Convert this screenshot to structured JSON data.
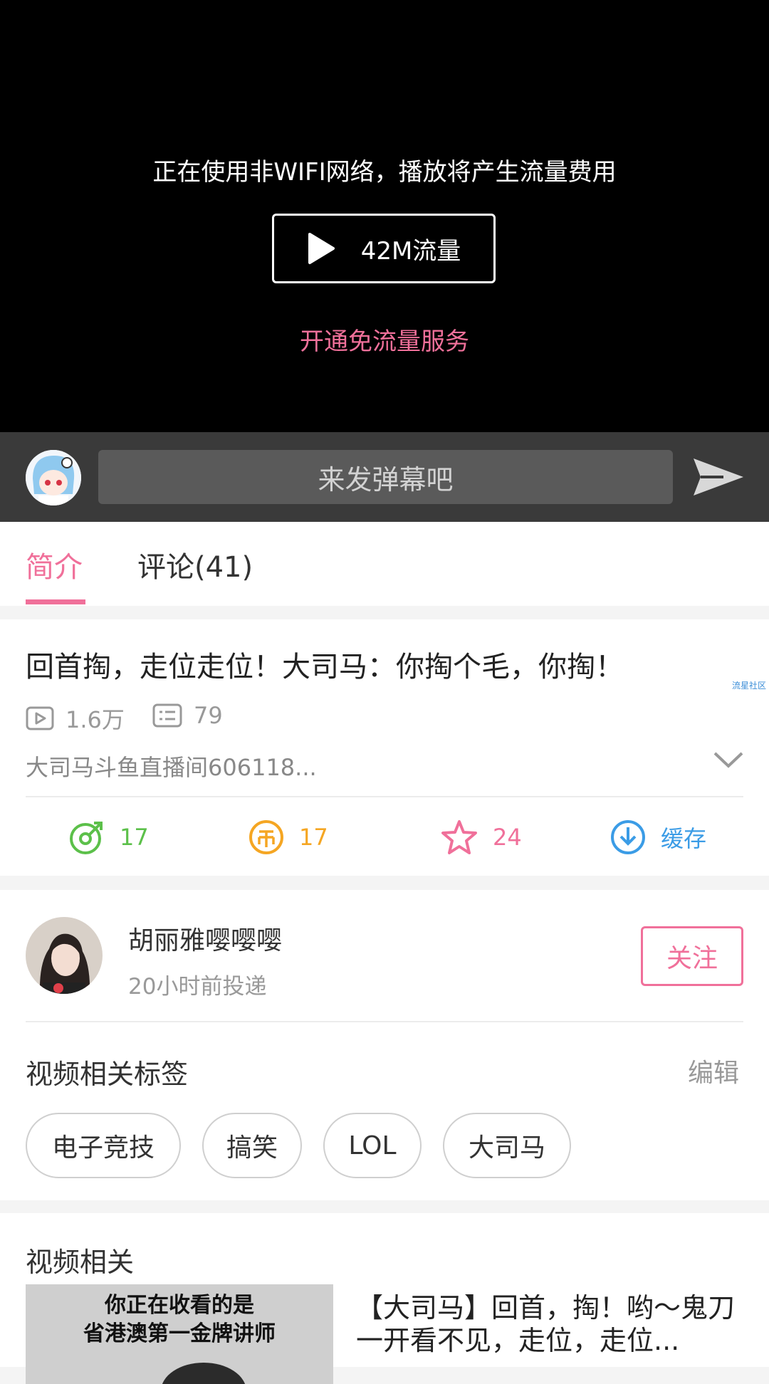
{
  "player": {
    "notice": "正在使用非WIFI网络，播放将产生流量费用",
    "play_label": "42M流量",
    "free_link": "开通免流量服务"
  },
  "danmaku": {
    "placeholder": "来发弹幕吧"
  },
  "tabs": [
    {
      "label": "简介",
      "active": true
    },
    {
      "label": "评论(41)",
      "active": false
    }
  ],
  "video": {
    "title": "回首掏，走位走位！大司马：你掏个毛，你掏！",
    "watermark": "流星社区",
    "views": "1.6万",
    "danmaku_count": "79",
    "description": "大司马斗鱼直播间606118..."
  },
  "actions": {
    "like": "17",
    "coin": "17",
    "favorite": "24",
    "cache": "缓存"
  },
  "uploader": {
    "name": "胡丽雅嘤嘤嘤",
    "time": "20小时前投递",
    "follow_label": "关注"
  },
  "tags_section": {
    "heading": "视频相关标签",
    "edit": "编辑",
    "tags": [
      "电子竞技",
      "搞笑",
      "LOL",
      "大司马"
    ]
  },
  "related": {
    "heading": "视频相关",
    "thumb_caption_1": "你正在收看的是",
    "thumb_caption_2": "省港澳第一金牌讲师",
    "title": "【大司马】回首，掏！哟～鬼刀一开看不见，走位，走位..."
  },
  "colors": {
    "accent": "#f0709a",
    "like": "#5cc04a",
    "coin": "#f5a623",
    "cache": "#3b9ce6"
  }
}
